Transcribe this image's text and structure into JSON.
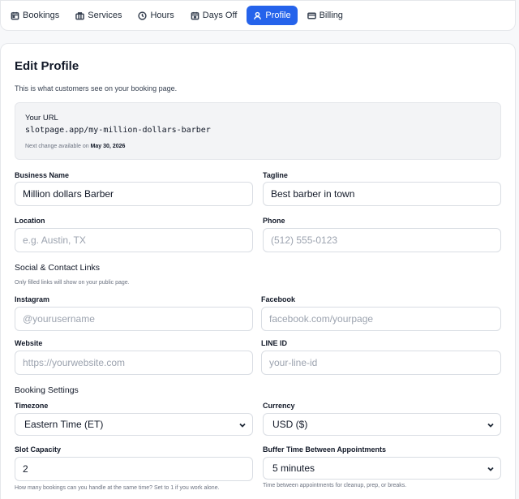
{
  "tabs": [
    {
      "label": "Bookings",
      "icon": "calendar-icon"
    },
    {
      "label": "Services",
      "icon": "briefcase-icon"
    },
    {
      "label": "Hours",
      "icon": "clock-icon"
    },
    {
      "label": "Days Off",
      "icon": "calendar-off-icon"
    },
    {
      "label": "Profile",
      "icon": "user-icon",
      "active": true
    },
    {
      "label": "Billing",
      "icon": "credit-card-icon"
    }
  ],
  "colors": {
    "accent": "#2563eb",
    "page_bg": "#f7f8fa",
    "border": "#e5e7eb"
  },
  "profile": {
    "title": "Edit Profile",
    "subtitle": "This is what customers see on your booking page.",
    "url_label": "Your URL",
    "url_value": "slotpage.app/my-million-dollars-barber",
    "url_note_prefix": "Next change available on",
    "url_note_date": "May 30, 2026"
  },
  "fields": {
    "business_name": {
      "label": "Business Name",
      "value": "Million dollars Barber"
    },
    "tagline": {
      "label": "Tagline",
      "value": "Best barber in town"
    },
    "location": {
      "label": "Location",
      "placeholder": "e.g. Austin, TX"
    },
    "phone": {
      "label": "Phone",
      "placeholder": "(512) 555-0123"
    }
  },
  "social": {
    "title": "Social & Contact Links",
    "helper": "Only filled links will show on your public page.",
    "instagram": {
      "label": "Instagram",
      "placeholder": "@yourusername"
    },
    "facebook": {
      "label": "Facebook",
      "placeholder": "facebook.com/yourpage"
    },
    "website": {
      "label": "Website",
      "placeholder": "https://yourwebsite.com"
    },
    "line": {
      "label": "LINE ID",
      "placeholder": "your-line-id"
    }
  },
  "booking": {
    "title": "Booking Settings",
    "timezone": {
      "label": "Timezone",
      "value": "Eastern Time (ET)"
    },
    "currency": {
      "label": "Currency",
      "value": "USD ($)"
    },
    "capacity": {
      "label": "Slot Capacity",
      "value": "2",
      "helper": "How many bookings can you handle at the same time? Set to 1 if you work alone."
    },
    "buffer": {
      "label": "Buffer Time Between Appointments",
      "value": "5 minutes",
      "helper": "Time between appointments for cleanup, prep, or breaks."
    }
  }
}
